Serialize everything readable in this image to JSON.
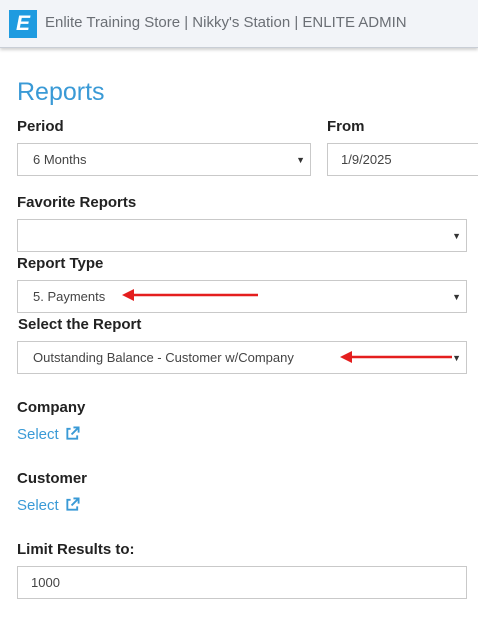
{
  "header": {
    "title": "Enlite Training Store | Nikky's Station | ENLITE ADMIN",
    "logo_letter": "E",
    "logo_color": "#1f9be0"
  },
  "page": {
    "title": "Reports"
  },
  "form": {
    "period": {
      "label": "Period",
      "value": "6 Months"
    },
    "from": {
      "label": "From",
      "value": "1/9/2025"
    },
    "favorite_reports": {
      "label": "Favorite Reports",
      "value": ""
    },
    "report_type": {
      "label": "Report Type",
      "value": "5. Payments"
    },
    "select_report": {
      "label": "Select the Report",
      "value": "Outstanding Balance - Customer w/Company"
    },
    "company": {
      "label": "Company",
      "link": "Select"
    },
    "customer": {
      "label": "Customer",
      "link": "Select"
    },
    "limit": {
      "label": "Limit Results to:",
      "value": "1000"
    }
  },
  "annotations": {
    "arrow_color": "#e41e1e"
  },
  "colors": {
    "accent": "#3a9ad6"
  }
}
